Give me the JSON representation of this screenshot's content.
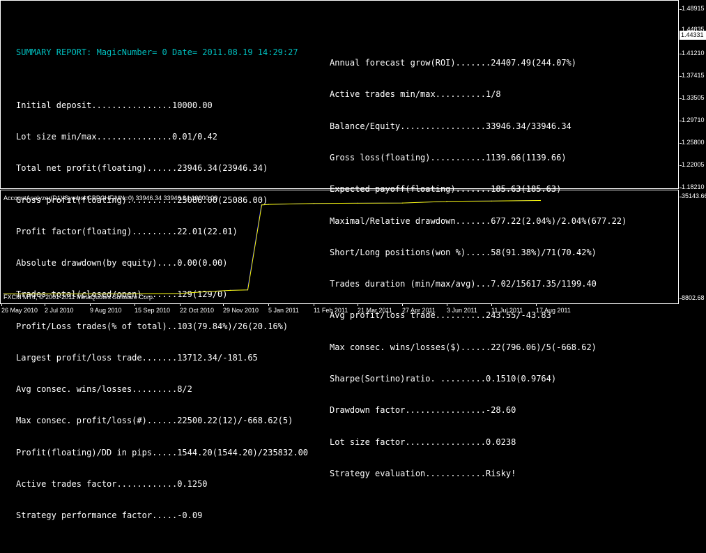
{
  "report": {
    "heading": "SUMMARY REPORT: MagicNumber= 0 Date= 2011.08.19 14:29:27",
    "left": [
      "Initial deposit................10000.00",
      "Lot size min/max...............0.01/0.42",
      "Total net profit(floating)......23946.34(23946.34)",
      "Gross profit(floating)..........25086.00(25086.00)",
      "Profit factor(floating).........22.01(22.01)",
      "Absolute drawdown(by equity)....0.00(0.00)",
      "Trades total(closed/open).......129(129/0)",
      "Profit/Loss trades(% of total)..103(79.84%)/26(20.16%)",
      "Largest profit/loss trade.......13712.34/-181.65",
      "Avg consec. wins/losses.........8/2",
      "Max consec. profit/loss(#)......22500.22(12)/-668.62(5)",
      "Profit(floating)/DD in pips.....1544.20(1544.20)/235832.00",
      "Active trades factor............0.1250",
      "Strategy performance factor.....-0.09"
    ],
    "right": [
      "Annual forecast grow(ROI).......24407.49(244.07%)",
      "Active trades min/max..........1/8",
      "Balance/Equity.................33946.34/33946.34",
      "Gross loss(floating)...........1139.66(1139.66)",
      "Expected payoff(floating).......185.63(185.63)",
      "Maximal/Relative drawdown.......677.22(2.04%)/2.04%(677.22)",
      "Short/Long positions(won %).....58(91.38%)/71(70.42%)",
      "Trades duration (min/max/avg)...7.02/15617.35/1199.40",
      "Avg profit/loss trade..........243.55/-43.83",
      "Max consec. wins/losses($)......22(796.06)/5(-668.62)",
      "Sharpe(Sortino)ratio. .........0.1510(0.9764)",
      "Drawdown factor................-28.60",
      "Lot size factor................0.0238",
      "Strategy evaluation............Risky!"
    ]
  },
  "price_scale": [
    "1.48915",
    "1.44835",
    "1.41210",
    "1.37415",
    "1.33505",
    "1.29710",
    "1.25800",
    "1.22005",
    "1.18210"
  ],
  "current_price": "1.44331",
  "indicator_label": "AccountAnalyzer(D1)|Symbol:GBPCHF|MN=0) 33946.34 33946.34 10000.00",
  "indicator_scale": {
    "max": "35143.66",
    "min": "8802.68"
  },
  "copyright": "FXCM MT4, © 2001-2011 MetaQuotes Software Corp.",
  "time_axis": [
    "26 May 2010",
    "2 Jul 2010",
    "9 Aug 2010",
    "15 Sep 2010",
    "22 Oct 2010",
    "29 Nov 2010",
    "5 Jan 2011",
    "11 Feb 2011",
    "21 Mar 2011",
    "27 Apr 2011",
    "3 Jun 2011",
    "11 Jul 2011",
    "17 Aug 2011"
  ],
  "chart_data": {
    "type": "line",
    "title": "AccountAnalyzer(D1)|Symbol:GBPCHF|MN=0) 33946.34 33946.34 10000.00",
    "x": [
      "26 May 2010",
      "2 Jul 2010",
      "9 Aug 2010",
      "15 Sep 2010",
      "22 Oct 2010",
      "15 Nov 2010",
      "29 Nov 2010",
      "10 Dec 2010",
      "13 Dec 2010",
      "5 Jan 2011",
      "11 Feb 2011",
      "21 Mar 2011",
      "27 Apr 2011",
      "5 May 2011",
      "3 Jun 2011",
      "11 Jul 2011",
      "17 Aug 2011"
    ],
    "series": [
      {
        "name": "Balance",
        "color": "#0000ff",
        "values": [
          10000,
          10000,
          10000,
          10050,
          10100,
          10600,
          10900,
          11000,
          33000,
          33150,
          33400,
          33450,
          33500,
          33900,
          33950,
          34000,
          34150
        ]
      },
      {
        "name": "Equity",
        "color": "#ffff00",
        "values": [
          10000,
          10000,
          10000,
          10050,
          10100,
          10600,
          10900,
          11000,
          33000,
          33150,
          33400,
          33450,
          33500,
          33900,
          33950,
          34000,
          34150
        ]
      }
    ],
    "ylim": [
      8802.68,
      35143.66
    ]
  }
}
